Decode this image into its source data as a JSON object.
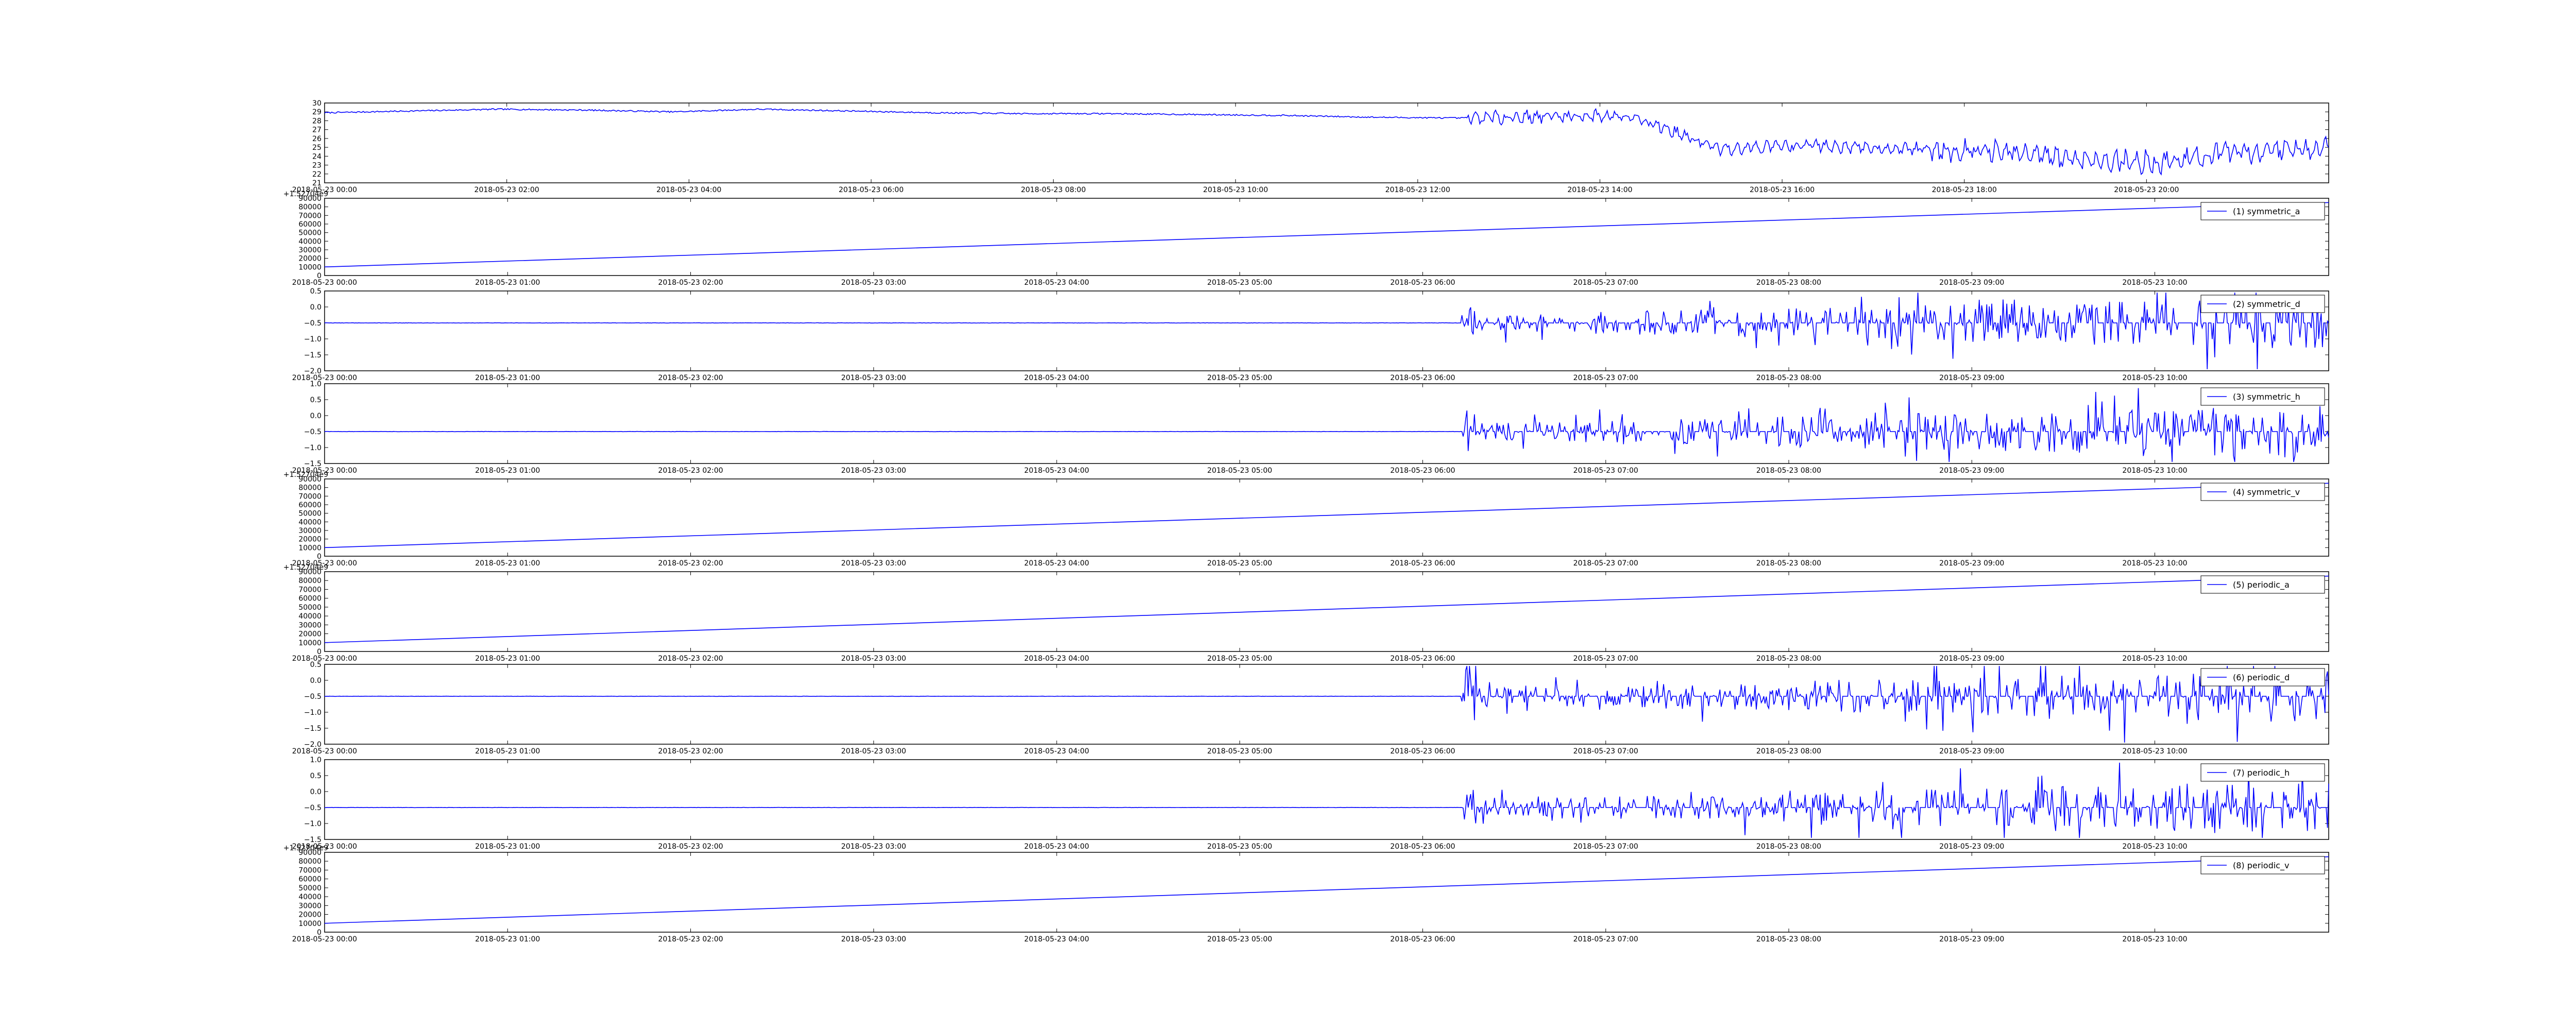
{
  "figure": {
    "background": "#ffffff",
    "line_color": "#0000ff",
    "axes_color": "#000000"
  },
  "chart_data": [
    {
      "type": "line",
      "series": [
        {
          "values_kind": "sampled",
          "x": [
            "2018-05-23 00:00",
            "2018-05-23 01:00",
            "2018-05-23 02:00",
            "2018-05-23 03:00",
            "2018-05-23 04:00",
            "2018-05-23 05:00",
            "2018-05-23 06:00",
            "2018-05-23 07:00",
            "2018-05-23 08:00",
            "2018-05-23 09:00",
            "2018-05-23 10:00",
            "2018-05-23 11:00",
            "2018-05-23 12:00",
            "2018-05-23 12:45",
            "2018-05-23 13:00",
            "2018-05-23 14:00",
            "2018-05-23 15:00",
            "2018-05-23 16:00",
            "2018-05-23 17:00",
            "2018-05-23 18:00",
            "2018-05-23 19:00",
            "2018-05-23 20:00",
            "2018-05-23 21:00",
            "2018-05-23 22:00"
          ],
          "values": [
            28.9,
            29.1,
            29.3,
            29.2,
            29.0,
            29.3,
            29.1,
            28.9,
            28.8,
            28.8,
            28.7,
            28.6,
            28.4,
            28.3,
            28.5,
            28.6,
            24.8,
            25.3,
            24.9,
            24.6,
            23.8,
            23.2,
            24.5,
            25.0
          ]
        }
      ],
      "x_ticks": [
        "2018-05-23 00:00",
        "2018-05-23 02:00",
        "2018-05-23 04:00",
        "2018-05-23 06:00",
        "2018-05-23 08:00",
        "2018-05-23 10:00",
        "2018-05-23 12:00",
        "2018-05-23 14:00",
        "2018-05-23 16:00",
        "2018-05-23 18:00",
        "2018-05-23 20:00"
      ],
      "y_ticks": [
        "21",
        "22",
        "23",
        "24",
        "25",
        "26",
        "27",
        "28",
        "29",
        "30"
      ],
      "ylim": [
        21,
        30
      ],
      "offset_text": "",
      "legend": ""
    },
    {
      "type": "line",
      "series": [
        {
          "name": "(1) symmetric_a",
          "values": [
            10000,
            85000
          ]
        }
      ],
      "x_ticks": [
        "2018-05-23 00:00",
        "2018-05-23 01:00",
        "2018-05-23 02:00",
        "2018-05-23 03:00",
        "2018-05-23 04:00",
        "2018-05-23 05:00",
        "2018-05-23 06:00",
        "2018-05-23 07:00",
        "2018-05-23 08:00",
        "2018-05-23 09:00",
        "2018-05-23 10:00"
      ],
      "y_ticks": [
        "0",
        "10000",
        "20000",
        "30000",
        "40000",
        "50000",
        "60000",
        "70000",
        "80000",
        "90000"
      ],
      "ylim": [
        0,
        90000
      ],
      "offset_text": "+1.52704e9",
      "legend": "(1) symmetric_a"
    },
    {
      "type": "line",
      "series": [
        {
          "name": "(2) symmetric_d",
          "values_kind": "noise",
          "base": -0.5
        }
      ],
      "x_ticks": [
        "2018-05-23 00:00",
        "2018-05-23 01:00",
        "2018-05-23 02:00",
        "2018-05-23 03:00",
        "2018-05-23 04:00",
        "2018-05-23 05:00",
        "2018-05-23 06:00",
        "2018-05-23 07:00",
        "2018-05-23 08:00",
        "2018-05-23 09:00",
        "2018-05-23 10:00"
      ],
      "y_ticks": [
        "−2.0",
        "−1.5",
        "−1.0",
        "−0.5",
        "0.0",
        "0.5"
      ],
      "ylim": [
        -2.0,
        0.5
      ],
      "offset_text": "",
      "legend": "(2) symmetric_d"
    },
    {
      "type": "line",
      "series": [
        {
          "name": "(3) symmetric_h",
          "values_kind": "noise",
          "base": -0.5
        }
      ],
      "x_ticks": [
        "2018-05-23 00:00",
        "2018-05-23 01:00",
        "2018-05-23 02:00",
        "2018-05-23 03:00",
        "2018-05-23 04:00",
        "2018-05-23 05:00",
        "2018-05-23 06:00",
        "2018-05-23 07:00",
        "2018-05-23 08:00",
        "2018-05-23 09:00",
        "2018-05-23 10:00"
      ],
      "y_ticks": [
        "−1.5",
        "−1.0",
        "−0.5",
        "0.0",
        "0.5",
        "1.0"
      ],
      "ylim": [
        -1.5,
        1.0
      ],
      "offset_text": "",
      "legend": "(3) symmetric_h"
    },
    {
      "type": "line",
      "series": [
        {
          "name": "(4) symmetric_v",
          "values": [
            10000,
            85000
          ]
        }
      ],
      "x_ticks": [
        "2018-05-23 00:00",
        "2018-05-23 01:00",
        "2018-05-23 02:00",
        "2018-05-23 03:00",
        "2018-05-23 04:00",
        "2018-05-23 05:00",
        "2018-05-23 06:00",
        "2018-05-23 07:00",
        "2018-05-23 08:00",
        "2018-05-23 09:00",
        "2018-05-23 10:00"
      ],
      "y_ticks": [
        "0",
        "10000",
        "20000",
        "30000",
        "40000",
        "50000",
        "60000",
        "70000",
        "80000",
        "90000"
      ],
      "ylim": [
        0,
        90000
      ],
      "offset_text": "+1.52704e9",
      "legend": "(4) symmetric_v"
    },
    {
      "type": "line",
      "series": [
        {
          "name": "(5) periodic_a",
          "values": [
            10000,
            85000
          ]
        }
      ],
      "x_ticks": [
        "2018-05-23 00:00",
        "2018-05-23 01:00",
        "2018-05-23 02:00",
        "2018-05-23 03:00",
        "2018-05-23 04:00",
        "2018-05-23 05:00",
        "2018-05-23 06:00",
        "2018-05-23 07:00",
        "2018-05-23 08:00",
        "2018-05-23 09:00",
        "2018-05-23 10:00"
      ],
      "y_ticks": [
        "0",
        "10000",
        "20000",
        "30000",
        "40000",
        "50000",
        "60000",
        "70000",
        "80000",
        "90000"
      ],
      "ylim": [
        0,
        90000
      ],
      "offset_text": "+1.52704e9",
      "legend": "(5) periodic_a"
    },
    {
      "type": "line",
      "series": [
        {
          "name": "(6) periodic_d",
          "values_kind": "noise",
          "base": -0.5
        }
      ],
      "x_ticks": [
        "2018-05-23 00:00",
        "2018-05-23 01:00",
        "2018-05-23 02:00",
        "2018-05-23 03:00",
        "2018-05-23 04:00",
        "2018-05-23 05:00",
        "2018-05-23 06:00",
        "2018-05-23 07:00",
        "2018-05-23 08:00",
        "2018-05-23 09:00",
        "2018-05-23 10:00"
      ],
      "y_ticks": [
        "−2.0",
        "−1.5",
        "−1.0",
        "−0.5",
        "0.0",
        "0.5"
      ],
      "ylim": [
        -2.0,
        0.5
      ],
      "offset_text": "",
      "legend": "(6) periodic_d"
    },
    {
      "type": "line",
      "series": [
        {
          "name": "(7) periodic_h",
          "values_kind": "noise",
          "base": -0.5
        }
      ],
      "x_ticks": [
        "2018-05-23 00:00",
        "2018-05-23 01:00",
        "2018-05-23 02:00",
        "2018-05-23 03:00",
        "2018-05-23 04:00",
        "2018-05-23 05:00",
        "2018-05-23 06:00",
        "2018-05-23 07:00",
        "2018-05-23 08:00",
        "2018-05-23 09:00",
        "2018-05-23 10:00"
      ],
      "y_ticks": [
        "−1.5",
        "−1.0",
        "−0.5",
        "0.0",
        "0.5",
        "1.0"
      ],
      "ylim": [
        -1.5,
        1.0
      ],
      "offset_text": "",
      "legend": "(7) periodic_h"
    },
    {
      "type": "line",
      "series": [
        {
          "name": "(8) periodic_v",
          "values": [
            10000,
            85000
          ]
        }
      ],
      "x_ticks": [
        "2018-05-23 00:00",
        "2018-05-23 01:00",
        "2018-05-23 02:00",
        "2018-05-23 03:00",
        "2018-05-23 04:00",
        "2018-05-23 05:00",
        "2018-05-23 06:00",
        "2018-05-23 07:00",
        "2018-05-23 08:00",
        "2018-05-23 09:00",
        "2018-05-23 10:00"
      ],
      "y_ticks": [
        "0",
        "10000",
        "20000",
        "30000",
        "40000",
        "50000",
        "60000",
        "70000",
        "80000",
        "90000"
      ],
      "ylim": [
        0,
        90000
      ],
      "offset_text": "+1.52704e9",
      "legend": "(8) periodic_v"
    }
  ]
}
